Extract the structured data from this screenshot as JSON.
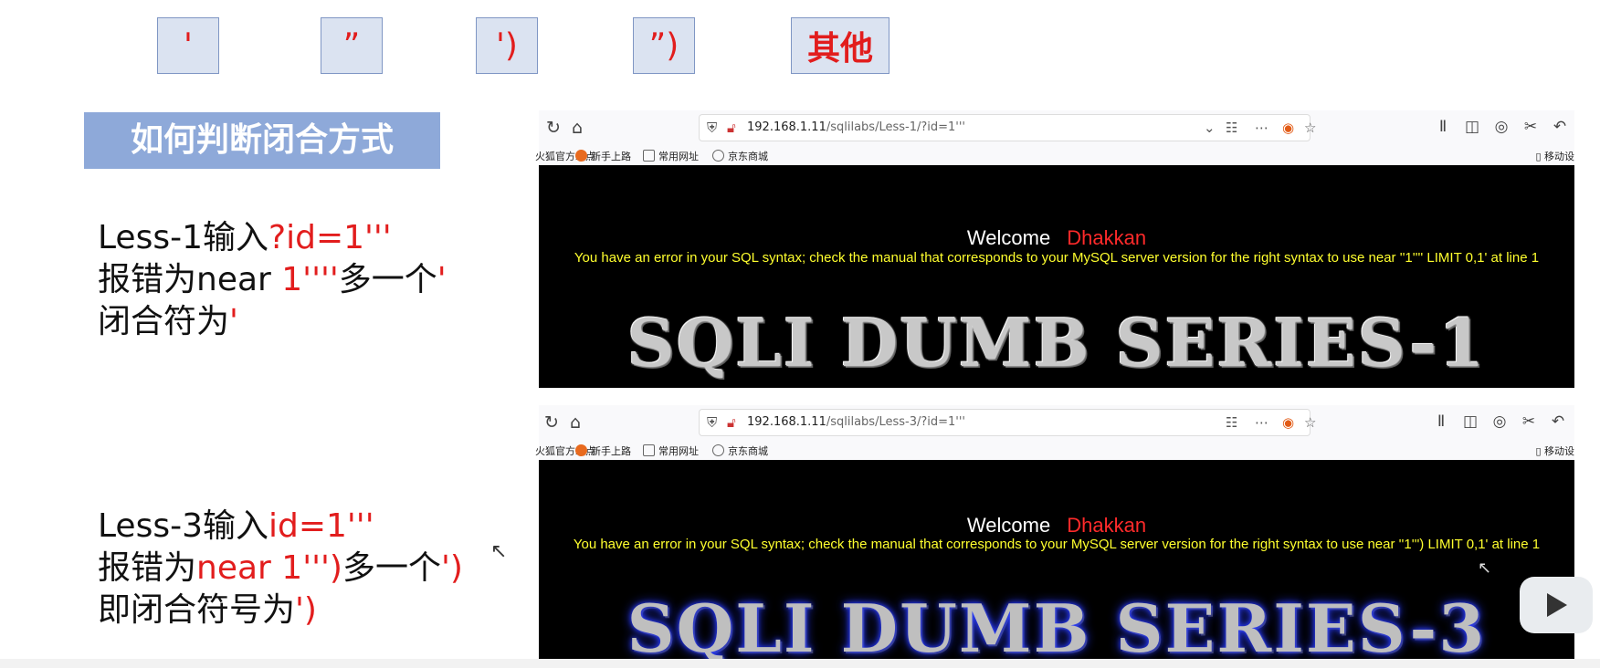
{
  "quote_options": [
    {
      "label": "'",
      "type": "sym"
    },
    {
      "label": "”",
      "type": "sym"
    },
    {
      "label": "')",
      "type": "sym"
    },
    {
      "label": "”)",
      "type": "sym"
    },
    {
      "label": "其他",
      "type": "other"
    }
  ],
  "banner": {
    "title": "如何判断闭合方式"
  },
  "less1": {
    "line1_a": "Less-1输入",
    "line1_b": "?id=1'''",
    "line2_a": "报错为near ",
    "line2_b": "1''''",
    "line2_c": "多一个",
    "line2_d": "'",
    "line3_a": "闭合符为",
    "line3_b": "'"
  },
  "less3": {
    "line1_a": "Less-3输入",
    "line1_b": "id=1'''",
    "line2_a": "报错为",
    "line2_b": "near 1''')",
    "line2_c": "多一个",
    "line2_d": "')",
    "line3_a": "即闭合符号为",
    "line3_b": "')"
  },
  "browser1": {
    "url_host": "192.168.1.11",
    "url_path": "/sqlilabs/Less-1/?id=1'''",
    "bookmarks": [
      "火狐官方站点",
      "新手上路",
      "常用网址",
      "京东商城"
    ],
    "right_label": "移动设",
    "welcome": "Welcome",
    "welcome_name": "Dhakkan",
    "error": "You have an error in your SQL syntax; check the manual that corresponds to your MySQL server version for the right syntax to use near ''1'''' LIMIT 0,1' at line 1",
    "series_title": "SQLI DUMB SERIES-1"
  },
  "browser2": {
    "url_host": "192.168.1.11",
    "url_path": "/sqlilabs/Less-3/?id=1'''",
    "bookmarks": [
      "火狐官方站点",
      "新手上路",
      "常用网址",
      "京东商城"
    ],
    "right_label": "移动设",
    "welcome": "Welcome",
    "welcome_name": "Dhakkan",
    "error": "You have an error in your SQL syntax; check the manual that corresponds to your MySQL server version for the right syntax to use near ''1''') LIMIT 0,1' at line 1",
    "series_title": "SQLI DUMB SERIES-3"
  },
  "colors": {
    "accent_red": "#e21d1d",
    "banner_blue": "#8ea9d9",
    "error_yellow": "#ffff2e"
  }
}
